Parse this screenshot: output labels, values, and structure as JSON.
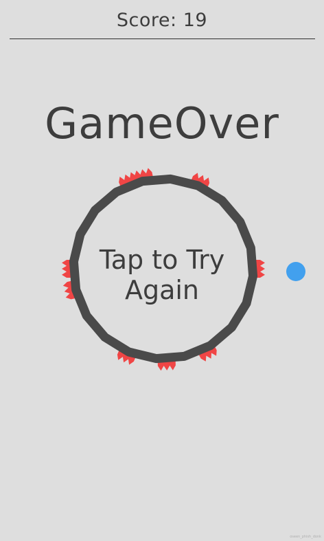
{
  "colors": {
    "background": "#dedede",
    "text": "#3d3d3d",
    "ring": "#4a4a4a",
    "spike": "#f04545",
    "ball": "#42a0ee",
    "divider": "#2f2f2f"
  },
  "header": {
    "score_label": "Score: 19"
  },
  "title": "GameOver",
  "retry": {
    "line1": "Tap to Try",
    "line2": "Again"
  },
  "ring": {
    "sides": 20,
    "spike_angles_deg": [
      -112,
      -102,
      -67,
      0,
      62,
      88,
      113,
      167,
      180
    ]
  },
  "watermark": "oseen_phish_donk"
}
